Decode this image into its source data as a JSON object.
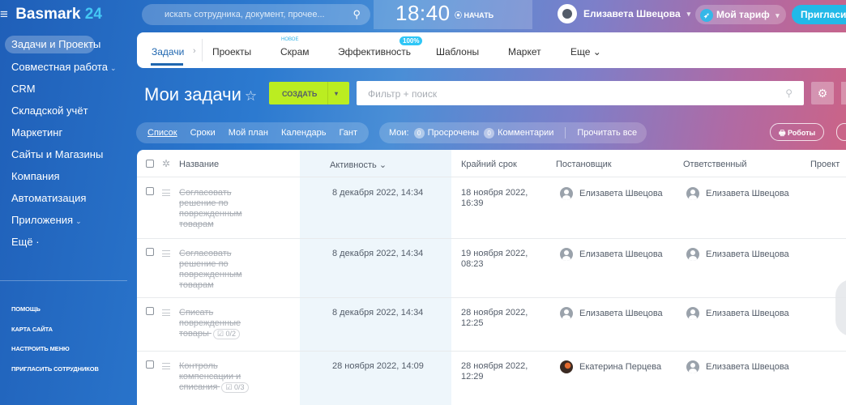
{
  "topbar": {
    "logo_word": "Basmark",
    "logo_num": "24",
    "menu_glyph": "≡",
    "search_placeholder": "искать сотрудника, документ, прочее...",
    "search_glyph": "⚲",
    "time": "18:40",
    "start_label": "⦿ НАЧАТЬ",
    "user_name": "Елизавета Швецова",
    "user_caret": "▾",
    "tariff_label": "Мой тариф",
    "tariff_caret": "▾",
    "invite_label": "Пригласить"
  },
  "sidebar": {
    "items": [
      {
        "label": "Задачи и Проекты",
        "caret": ""
      },
      {
        "label": "Совместная работа",
        "caret": "⌄"
      },
      {
        "label": "CRM",
        "caret": ""
      },
      {
        "label": "Складской учёт",
        "caret": ""
      },
      {
        "label": "Маркетинг",
        "caret": ""
      },
      {
        "label": "Сайты и Магазины",
        "caret": ""
      },
      {
        "label": "Компания",
        "caret": ""
      },
      {
        "label": "Автоматизация",
        "caret": ""
      },
      {
        "label": "Приложения",
        "caret": "⌄"
      },
      {
        "label": "Ещё ·",
        "caret": ""
      }
    ],
    "links": [
      "ПОМОЩЬ",
      "КАРТА САЙТА",
      "НАСТРОИТЬ МЕНЮ",
      "ПРИГЛАСИТЬ СОТРУДНИКОВ"
    ]
  },
  "tabs": {
    "items": [
      "Задачи",
      "Проекты",
      "Скрам",
      "Эффективность",
      "Шаблоны",
      "Маркет",
      "Еще ⌄"
    ],
    "breadcrumb_sep": "›",
    "badge_new": "новое",
    "badge_pct": "100%"
  },
  "page": {
    "title": "Мои задачи",
    "star": "☆",
    "create_label": "СОЗДАТЬ",
    "create_caret": "▾",
    "filter_placeholder": "Фильтр + поиск",
    "filter_glyph": "⚲",
    "gear_glyph": "⚙"
  },
  "views": [
    "Список",
    "Сроки",
    "Мой план",
    "Календарь",
    "Гант"
  ],
  "counters": {
    "mine_label": "Мои:",
    "overdue_count": "0",
    "overdue_label": "Просрочены",
    "comments_count": "0",
    "comments_label": "Комментарии",
    "read_all": "Прочитать все"
  },
  "robots_label": "🖶 Роботы",
  "table": {
    "columns": [
      "Название",
      "Активность ⌄",
      "Крайний срок",
      "Постановщик",
      "Ответственный",
      "Проект"
    ],
    "head_gear": "✲",
    "rows": [
      {
        "name": "Согласовать решение по поврежденным товарам",
        "checklist": "",
        "activity": "8 декабря 2022, 14:34",
        "deadline": "18 ноября 2022, 16:39",
        "creator": "Елизавета Швецова",
        "creator_photo": false,
        "responsible": "Елизавета Швецова"
      },
      {
        "name": "Согласовать решение по поврежденным товарам",
        "checklist": "",
        "activity": "8 декабря 2022, 14:34",
        "deadline": "19 ноября 2022, 08:23",
        "creator": "Елизавета Швецова",
        "creator_photo": false,
        "responsible": "Елизавета Швецова"
      },
      {
        "name": "Списать поврежденные товары",
        "checklist": "☑ 0/2",
        "activity": "8 декабря 2022, 14:34",
        "deadline": "28 ноября 2022, 12:25",
        "creator": "Елизавета Швецова",
        "creator_photo": false,
        "responsible": "Елизавета Швецова"
      },
      {
        "name": "Контроль компенсации и списания",
        "checklist": "☑ 0/3",
        "activity": "28 ноября 2022, 14:09",
        "deadline": "28 ноября 2022, 12:29",
        "creator": "Екатерина Перцева",
        "creator_photo": true,
        "responsible": "Елизавета Швецова"
      }
    ]
  }
}
